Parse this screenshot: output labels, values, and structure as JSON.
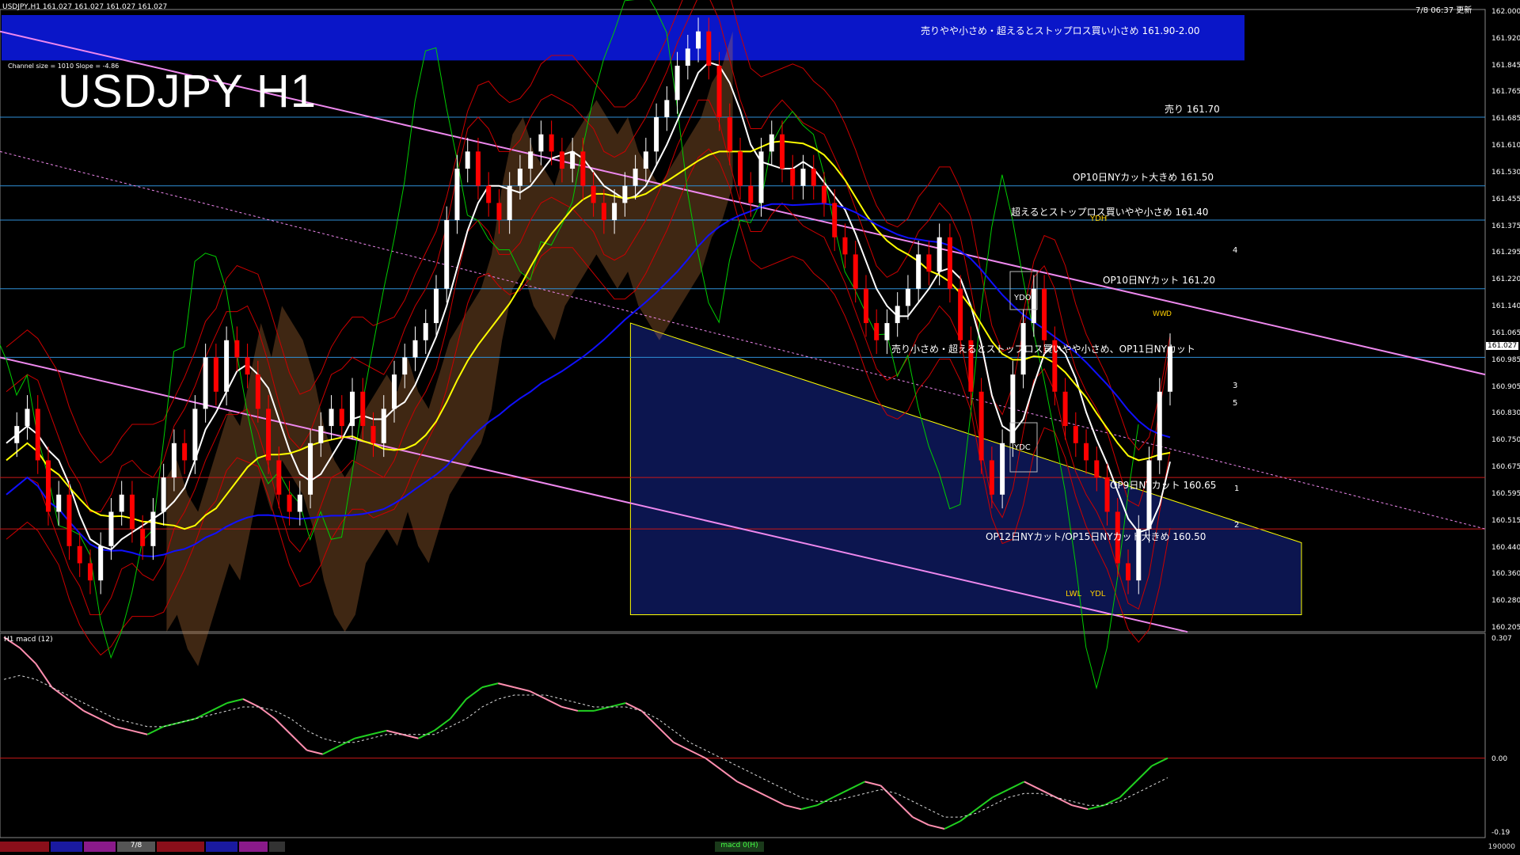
{
  "header": {
    "symbol_info": "USDJPY,H1  161.027 161.027 161.027 161.027",
    "datetime": "7/8 06:37 更新",
    "channel_info": "Channel size = 1010 Slope = -4.86",
    "big_title": "USDJPY H1"
  },
  "price_axis": {
    "labels": [
      "162.000",
      "161.920",
      "161.845",
      "161.765",
      "161.685",
      "161.610",
      "161.530",
      "161.455",
      "161.375",
      "161.295",
      "161.220",
      "161.140",
      "161.065",
      "160.985",
      "160.905",
      "160.830",
      "160.750",
      "160.675",
      "160.595",
      "160.515",
      "160.440",
      "160.360",
      "160.280",
      "160.205"
    ],
    "current": "161.027"
  },
  "annotations": [
    {
      "id": "sell-zone",
      "text": "売りやや小さめ・超えるとストップロス買い小さめ 161.90-2.00"
    },
    {
      "id": "sell-161-70",
      "text": "売り 161.70"
    },
    {
      "id": "op10-161-50",
      "text": "OP10日NYカット大きめ 161.50"
    },
    {
      "id": "stop-161-40",
      "text": "超えるとストップロス買いやや小さめ 161.40"
    },
    {
      "id": "op10-161-20",
      "text": "OP10日NYカット 161.20"
    },
    {
      "id": "op11",
      "text": "売り小さめ・超えるとストップロス買いやや小さめ、OP11日NYカット"
    },
    {
      "id": "op9-160-65",
      "text": "OP9日NYカット 160.65"
    },
    {
      "id": "op12-160-50",
      "text": "OP12日NYカット/OP15日NYカット大きめ 160.50"
    }
  ],
  "chart_markers": {
    "ydo": "YDO",
    "ydc": "YDC",
    "ydh": "YDH",
    "ydl": "YDL",
    "lwl": "LWL",
    "ww": "WW",
    "d": "D",
    "wave_labels": [
      "4",
      "3",
      "5",
      "1",
      "2"
    ]
  },
  "macd_panel": {
    "label": "H1  macd (12)",
    "top_value": "0.307",
    "zero_value": "0.00",
    "bottom_value": "-0.19"
  },
  "bottom_bar": {
    "date_tab": "7/8",
    "indicator_tab": "macd 0(H)",
    "right_value": "190000"
  },
  "colors": {
    "up_candle": "#ffffff",
    "down_candle": "#ff0000",
    "ma_fast": "#ffffff",
    "ma_mid": "#ffff00",
    "ma_slow": "#1010ff",
    "chikou": "#00cc00",
    "bollinger": "#cc0000",
    "channel": "#ee88ee",
    "cloud_blue": "#1a2eb0",
    "cloud_orange": "#d08040",
    "level_blue": "#2f8fd8",
    "level_red": "#c81818",
    "sell_zone": "#0a16c8",
    "macd_main_up": "#20d020",
    "macd_main_down": "#ff8fb0"
  },
  "chart_data": {
    "type": "candlestick",
    "instrument": "USDJPY",
    "timeframe": "H1",
    "y_range": [
      160.205,
      162.0
    ],
    "levels": [
      {
        "price": 161.7,
        "label": "売り 161.70"
      },
      {
        "price": 161.5,
        "label": "OP10日NYカット大きめ 161.50"
      },
      {
        "price": 161.4,
        "label": "超えるとストップロス買いやや小さめ 161.40"
      },
      {
        "price": 161.2,
        "label": "OP10日NYカット 161.20"
      },
      {
        "price": 161.0,
        "label": "売り小さめ・超えるとストップロス買いやや小さめ、OP11日NYカット"
      },
      {
        "price": 160.65,
        "label": "OP9日NYカット 160.65"
      },
      {
        "price": 160.5,
        "label": "OP12日NYカット/OP15日NYカット大きめ 160.50"
      }
    ],
    "zones": [
      {
        "from": 161.9,
        "to": 162.0,
        "label": "売りやや小さめ・超えるとストップロス買い小さめ 161.90-2.00"
      }
    ],
    "close_path": [
      160.75,
      160.8,
      160.85,
      160.7,
      160.55,
      160.6,
      160.45,
      160.4,
      160.35,
      160.45,
      160.55,
      160.6,
      160.5,
      160.45,
      160.55,
      160.65,
      160.75,
      160.7,
      160.85,
      161.0,
      160.9,
      161.05,
      161.0,
      160.95,
      160.85,
      160.7,
      160.6,
      160.55,
      160.6,
      160.75,
      160.8,
      160.85,
      160.8,
      160.9,
      160.8,
      160.75,
      160.85,
      160.95,
      161.0,
      161.05,
      161.1,
      161.2,
      161.4,
      161.55,
      161.6,
      161.5,
      161.45,
      161.4,
      161.5,
      161.55,
      161.6,
      161.65,
      161.6,
      161.55,
      161.6,
      161.5,
      161.45,
      161.4,
      161.45,
      161.5,
      161.55,
      161.6,
      161.7,
      161.75,
      161.85,
      161.9,
      161.95,
      161.85,
      161.7,
      161.6,
      161.5,
      161.45,
      161.6,
      161.65,
      161.55,
      161.5,
      161.55,
      161.5,
      161.45,
      161.35,
      161.3,
      161.2,
      161.1,
      161.05,
      161.1,
      161.15,
      161.2,
      161.3,
      161.25,
      161.35,
      161.2,
      161.05,
      160.9,
      160.7,
      160.6,
      160.75,
      160.95,
      161.1,
      161.2,
      161.05,
      160.9,
      160.8,
      160.75,
      160.7,
      160.65,
      160.55,
      160.4,
      160.35,
      160.5,
      160.7,
      160.9,
      161.03
    ],
    "macd_main": [
      0.307,
      0.28,
      0.24,
      0.18,
      0.15,
      0.12,
      0.1,
      0.08,
      0.07,
      0.06,
      0.08,
      0.09,
      0.1,
      0.12,
      0.14,
      0.15,
      0.13,
      0.1,
      0.06,
      0.02,
      0.01,
      0.03,
      0.05,
      0.06,
      0.07,
      0.06,
      0.05,
      0.07,
      0.1,
      0.15,
      0.18,
      0.19,
      0.18,
      0.17,
      0.15,
      0.13,
      0.12,
      0.12,
      0.13,
      0.14,
      0.12,
      0.08,
      0.04,
      0.02,
      0.0,
      -0.03,
      -0.06,
      -0.08,
      -0.1,
      -0.12,
      -0.13,
      -0.12,
      -0.1,
      -0.08,
      -0.06,
      -0.07,
      -0.11,
      -0.15,
      -0.17,
      -0.18,
      -0.16,
      -0.13,
      -0.1,
      -0.08,
      -0.06,
      -0.08,
      -0.1,
      -0.12,
      -0.13,
      -0.12,
      -0.1,
      -0.06,
      -0.02,
      0.0
    ],
    "macd_signal": [
      0.2,
      0.21,
      0.2,
      0.18,
      0.16,
      0.14,
      0.12,
      0.1,
      0.09,
      0.08,
      0.08,
      0.09,
      0.1,
      0.11,
      0.12,
      0.13,
      0.13,
      0.12,
      0.1,
      0.07,
      0.05,
      0.04,
      0.04,
      0.05,
      0.06,
      0.06,
      0.06,
      0.06,
      0.08,
      0.1,
      0.13,
      0.15,
      0.16,
      0.16,
      0.16,
      0.15,
      0.14,
      0.13,
      0.13,
      0.13,
      0.12,
      0.1,
      0.07,
      0.04,
      0.02,
      0.0,
      -0.02,
      -0.04,
      -0.06,
      -0.08,
      -0.1,
      -0.11,
      -0.11,
      -0.1,
      -0.09,
      -0.08,
      -0.09,
      -0.11,
      -0.13,
      -0.15,
      -0.15,
      -0.14,
      -0.12,
      -0.1,
      -0.09,
      -0.09,
      -0.1,
      -0.11,
      -0.12,
      -0.12,
      -0.11,
      -0.09,
      -0.07,
      -0.05
    ]
  }
}
